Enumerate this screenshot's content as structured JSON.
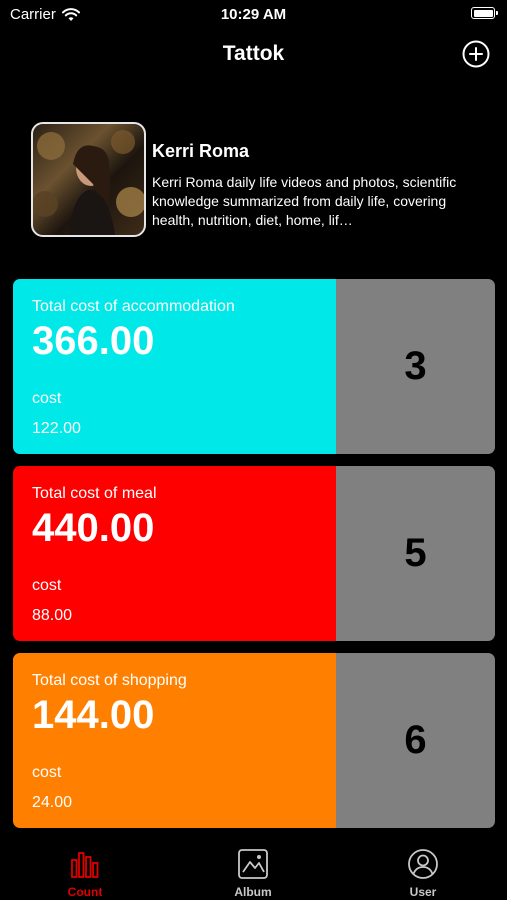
{
  "status_bar": {
    "carrier": "Carrier",
    "time": "10:29 AM"
  },
  "nav": {
    "title": "Tattok",
    "add_icon": "plus-circle-icon"
  },
  "profile": {
    "name": "Kerri Roma",
    "description": "Kerri Roma daily life videos and photos, scientific knowledge summarized from daily life, covering health, nutrition, diet, home, lif…"
  },
  "cards": [
    {
      "title": "Total cost of accommodation",
      "total": "366.00",
      "cost_label": "cost",
      "cost_value": "122.00",
      "count": "3",
      "color": "#00e8e8"
    },
    {
      "title": "Total cost of meal",
      "total": "440.00",
      "cost_label": "cost",
      "cost_value": "88.00",
      "count": "5",
      "color": "#ff0000"
    },
    {
      "title": "Total cost of shopping",
      "total": "144.00",
      "cost_label": "cost",
      "cost_value": "24.00",
      "count": "6",
      "color": "#ff8000"
    }
  ],
  "tabs": [
    {
      "label": "Count",
      "icon": "bar-chart-icon",
      "active": true,
      "color": "#e00000"
    },
    {
      "label": "Album",
      "icon": "photo-album-icon",
      "active": false,
      "color": "#c8c8c8"
    },
    {
      "label": "User",
      "icon": "user-icon",
      "active": false,
      "color": "#c8c8c8"
    }
  ]
}
